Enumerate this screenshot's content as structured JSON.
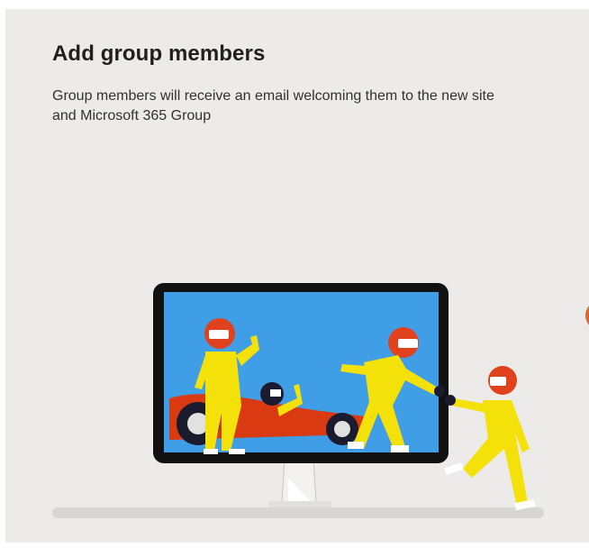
{
  "panel": {
    "title": "Add group members",
    "description": "Group members will receive an email welcoming them to the new site and Microsoft 365 Group"
  },
  "illustration": {
    "icon": "team-handoff-illustration",
    "colors": {
      "screen": "#3f9ee6",
      "suit": "#f5e10a",
      "helmet": "#e0421e",
      "car": "#d93a12",
      "bezel": "#111111"
    }
  }
}
